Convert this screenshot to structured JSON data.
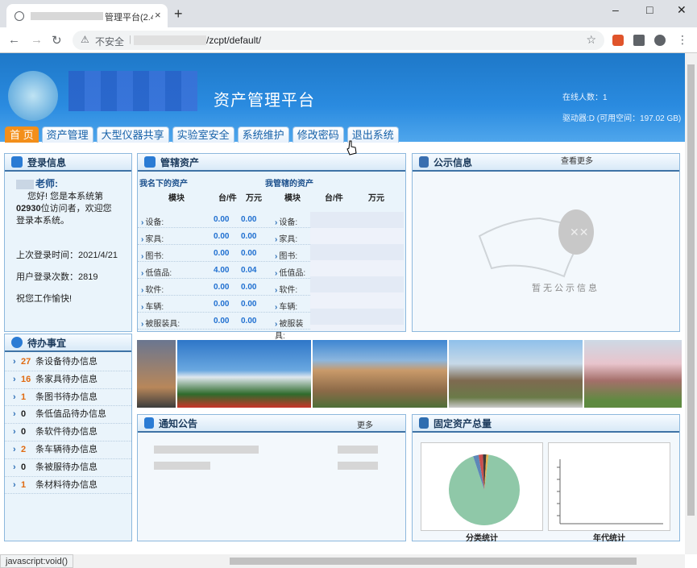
{
  "browser": {
    "tab_title": "管理平台(2.4",
    "tab_close": "×",
    "new_tab": "+",
    "security_label": "不安全",
    "url": "/zcpt/default/",
    "status_text": "javascript:void()"
  },
  "header": {
    "platform_title": "资产管理平台",
    "online_users": "在线人数：1",
    "drive_info": "驱动器:D (可用空间：197.02 GB)"
  },
  "menu": [
    "首 页",
    "资产管理",
    "大型仪器共享",
    "实验室安全",
    "系统维护",
    "修改密码",
    "退出系统"
  ],
  "login": {
    "title": "登录信息",
    "greeting_name": "老师:",
    "greeting_line1": "您好! 您是本系统第",
    "visitor_no": "02930",
    "greeting_line2": "位访问者，欢迎您登录本系统。",
    "last_login": "上次登录时间：2021/4/21",
    "login_count": "用户登录次数：2819",
    "wish": "祝您工作愉快!"
  },
  "assets": {
    "title": "管辖资产",
    "my_title": "我名下的资产",
    "managed_title": "我管辖的资产",
    "col_module": "模块",
    "col_unit": "台/件",
    "col_wan": "万元",
    "rows": [
      {
        "cat": "设备:",
        "units": "0.00",
        "wan": "0.00"
      },
      {
        "cat": "家具:",
        "units": "0.00",
        "wan": "0.00"
      },
      {
        "cat": "图书:",
        "units": "0.00",
        "wan": "0.00"
      },
      {
        "cat": "低值品:",
        "units": "4.00",
        "wan": "0.04"
      },
      {
        "cat": "软件:",
        "units": "0.00",
        "wan": "0.00"
      },
      {
        "cat": "车辆:",
        "units": "0.00",
        "wan": "0.00"
      },
      {
        "cat": "被服装具:",
        "units": "0.00",
        "wan": "0.00"
      }
    ]
  },
  "public_info": {
    "title": "公示信息",
    "more": "查看更多",
    "empty_text": "暂无公示信息"
  },
  "todo": {
    "title": "待办事宜",
    "items": [
      {
        "count": "27",
        "text": "条设备待办信息",
        "color": "#e06a10"
      },
      {
        "count": "16",
        "text": "条家具待办信息",
        "color": "#e06a10"
      },
      {
        "count": "1",
        "text": "条图书待办信息",
        "color": "#e06a10"
      },
      {
        "count": "0",
        "text": "条低值品待办信息",
        "color": "#222222"
      },
      {
        "count": "0",
        "text": "条软件待办信息",
        "color": "#222222"
      },
      {
        "count": "2",
        "text": "条车辆待办信息",
        "color": "#e06a10"
      },
      {
        "count": "0",
        "text": "条被服待办信息",
        "color": "#222222"
      },
      {
        "count": "1",
        "text": "条材料待办信息",
        "color": "#e06a10"
      }
    ]
  },
  "notice": {
    "title": "通知公告",
    "more": "更多"
  },
  "fixed_assets": {
    "title": "固定资产总量",
    "pie_label": "分类统计",
    "year_label": "年代统计"
  },
  "chart_data": {
    "type": "pie",
    "title": "分类统计",
    "slices": [
      {
        "value": 93,
        "color": "#8fc8a8"
      },
      {
        "value": 2.5,
        "color": "#5d87b8"
      },
      {
        "value": 2,
        "color": "#c94f4f"
      },
      {
        "value": 1.5,
        "color": "#3a3a3a"
      },
      {
        "value": 1,
        "color": "#e6b14a"
      }
    ]
  }
}
